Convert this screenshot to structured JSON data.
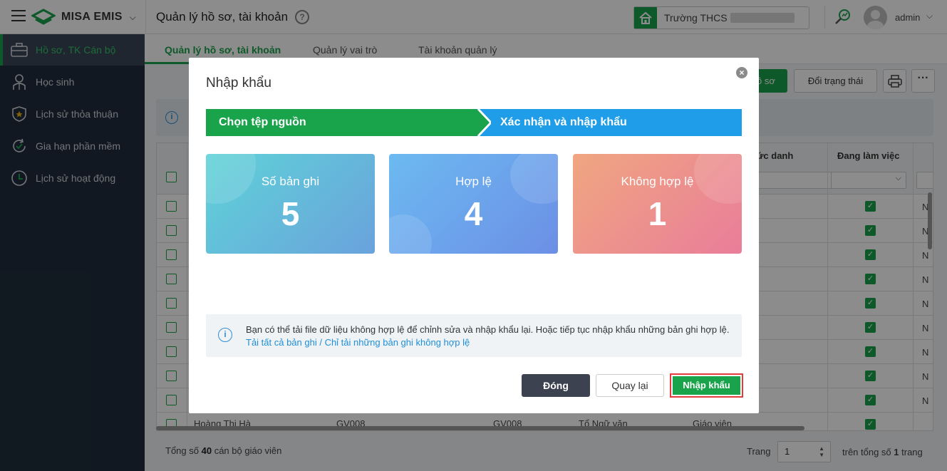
{
  "app": {
    "brand": "MISA EMIS",
    "page_title": "Quản lý hồ sơ, tài khoản",
    "school_prefix": "Trường THCS",
    "user": "admin"
  },
  "sidebar": {
    "items": [
      {
        "label": "Hồ sơ, TK Cán bộ",
        "icon": "briefcase-icon",
        "active": true
      },
      {
        "label": "Học sinh",
        "icon": "student-icon",
        "active": false
      },
      {
        "label": "Lịch sử thỏa thuận",
        "icon": "shield-star-icon",
        "active": false
      },
      {
        "label": "Gia hạn phần mềm",
        "icon": "renew-icon",
        "active": false
      },
      {
        "label": "Lịch sử hoạt động",
        "icon": "clock-icon",
        "active": false
      }
    ]
  },
  "tabs": [
    {
      "label": "Quản lý hồ sơ, tài khoản",
      "active": true
    },
    {
      "label": "Quản lý vai trò",
      "active": false
    },
    {
      "label": "Tài khoản quản lý",
      "active": false
    }
  ],
  "toolbar": {
    "add_partial": "ồ sơ",
    "change_status": "Đổi trạng thái"
  },
  "table": {
    "headers": {
      "position": "ức danh",
      "working": "Đang làm việc"
    },
    "last_row": {
      "name": "Hoàng Thị Hà",
      "code1": "GV008",
      "code2": "GV008",
      "group": "Tổ Ngữ văn",
      "position": "Giáo viên"
    },
    "truncated_cell": "N"
  },
  "footer": {
    "total_prefix": "Tổng số",
    "total_count": "40",
    "total_suffix": "cán bộ giáo viên",
    "page_label": "Trang",
    "page_value": "1",
    "page_total_prefix": "trên tổng số",
    "page_total_count": "1",
    "page_total_suffix": "trang"
  },
  "modal": {
    "title": "Nhập khẩu",
    "steps": [
      "Chọn tệp nguồn",
      "Xác nhận và nhập khẩu"
    ],
    "cards": [
      {
        "label": "Số bản ghi",
        "value": "5"
      },
      {
        "label": "Hợp lệ",
        "value": "4"
      },
      {
        "label": "Không hợp lệ",
        "value": "1"
      }
    ],
    "notice_text": "Bạn có thể tải file dữ liệu không hợp lệ để chỉnh sửa và nhập khẩu lại. Hoặc tiếp tục nhập khẩu những bản ghi hợp lệ.",
    "notice_link": "Tải tất cả bản ghi / Chỉ tải những bản ghi không hợp lệ",
    "buttons": {
      "close": "Đóng",
      "back": "Quay lại",
      "import": "Nhập khẩu"
    }
  },
  "colors": {
    "primary_green": "#19a34b",
    "step_blue": "#1f9de8",
    "sidebar_bg": "#1f2d3d",
    "highlight_red": "#e23b3b"
  }
}
